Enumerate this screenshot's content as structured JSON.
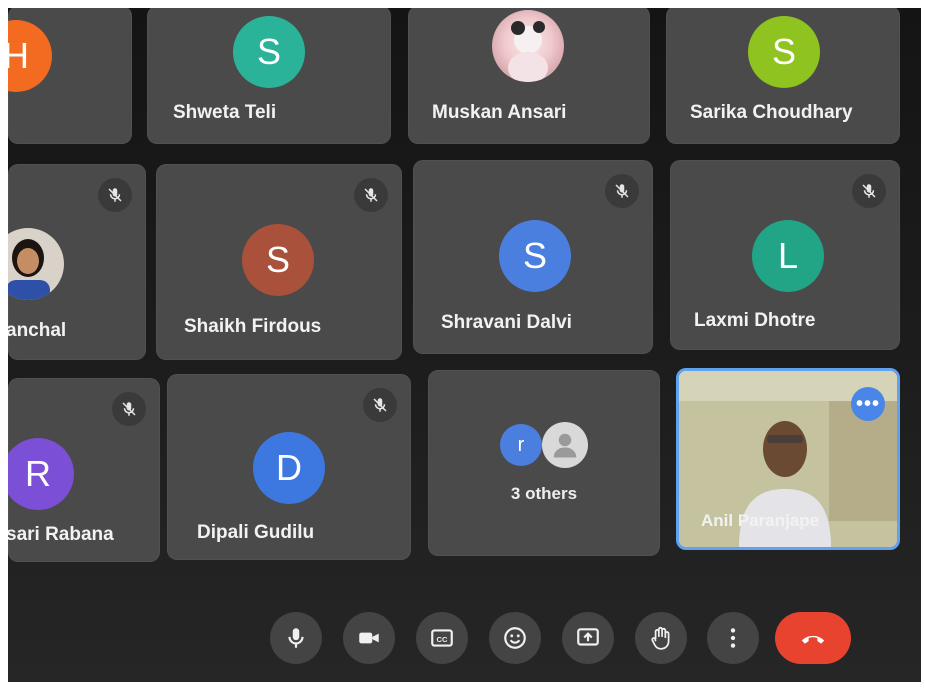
{
  "participants": [
    {
      "name": "",
      "initial": "H",
      "color": "#f26b21",
      "muted": false
    },
    {
      "name": "Shweta Teli",
      "initial": "S",
      "color": "#2bb39a",
      "muted": false
    },
    {
      "name": "Muskan Ansari",
      "initial": "",
      "color": "#e9d6d6",
      "muted": false,
      "photo": true
    },
    {
      "name": "Sarika Choudhary",
      "initial": "S",
      "color": "#8fc31f",
      "muted": false
    },
    {
      "name": "anchal",
      "initial": "",
      "color": "#c9a27a",
      "muted": true,
      "photo": true
    },
    {
      "name": "Shaikh Firdous",
      "initial": "S",
      "color": "#a9513a",
      "muted": true
    },
    {
      "name": "Shravani Dalvi",
      "initial": "S",
      "color": "#4a7fe0",
      "muted": true
    },
    {
      "name": "Laxmi Dhotre",
      "initial": "L",
      "color": "#21a586",
      "muted": true
    },
    {
      "name": "sari Rabana",
      "initial": "R",
      "color": "#7b4fd6",
      "muted": true
    },
    {
      "name": "Dipali Gudilu",
      "initial": "D",
      "color": "#3d78e0",
      "muted": true
    },
    {
      "name": "Anil Paranjape",
      "initial": "",
      "color": "#c9b98a",
      "muted": false,
      "video": true
    }
  ],
  "others": {
    "label": "3 others",
    "initial": "r"
  },
  "controls": {
    "icons": [
      "microphone-icon",
      "camera-icon",
      "captions-icon",
      "emoji-icon",
      "present-icon",
      "raise-hand-icon",
      "more-options-icon",
      "end-call-icon"
    ],
    "captions_text": "CC",
    "more_dots": "•••"
  }
}
